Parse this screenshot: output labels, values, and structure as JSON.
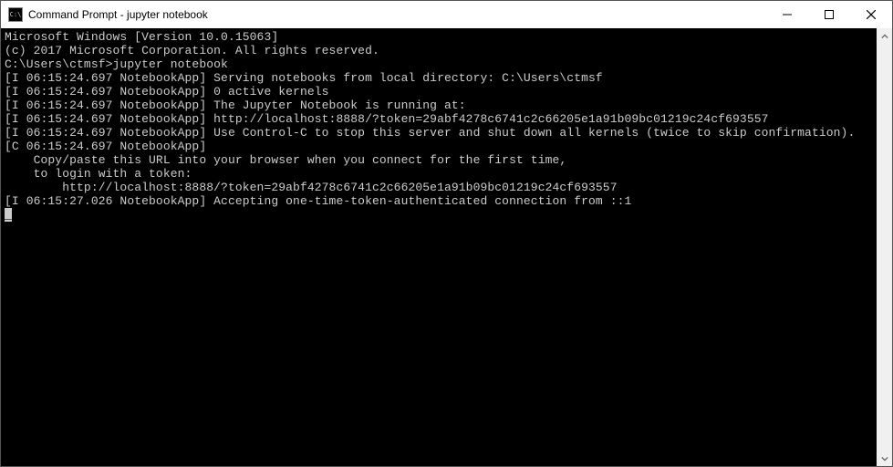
{
  "window": {
    "title": "Command Prompt - jupyter  notebook"
  },
  "terminal": {
    "lines": [
      "Microsoft Windows [Version 10.0.15063]",
      "(c) 2017 Microsoft Corporation. All rights reserved.",
      "",
      "C:\\Users\\ctmsf>jupyter notebook",
      "[I 06:15:24.697 NotebookApp] Serving notebooks from local directory: C:\\Users\\ctmsf",
      "[I 06:15:24.697 NotebookApp] 0 active kernels",
      "[I 06:15:24.697 NotebookApp] The Jupyter Notebook is running at:",
      "[I 06:15:24.697 NotebookApp] http://localhost:8888/?token=29abf4278c6741c2c66205e1a91b09bc01219c24cf693557",
      "[I 06:15:24.697 NotebookApp] Use Control-C to stop this server and shut down all kernels (twice to skip confirmation).",
      "[C 06:15:24.697 NotebookApp]",
      "",
      "    Copy/paste this URL into your browser when you connect for the first time,",
      "    to login with a token:",
      "        http://localhost:8888/?token=29abf4278c6741c2c66205e1a91b09bc01219c24cf693557",
      "[I 06:15:27.026 NotebookApp] Accepting one-time-token-authenticated connection from ::1"
    ],
    "cursor": "_"
  }
}
